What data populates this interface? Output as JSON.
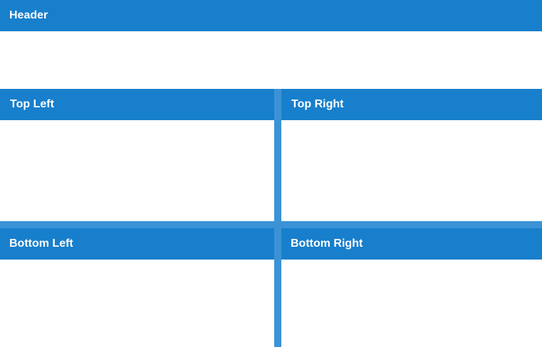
{
  "header": {
    "title": "Header"
  },
  "panes": {
    "top_left": {
      "title": "Top Left"
    },
    "top_right": {
      "title": "Top Right"
    },
    "bottom_left": {
      "title": "Bottom Left"
    },
    "bottom_right": {
      "title": "Bottom Right"
    }
  },
  "colors": {
    "header_bg": "#187fcc",
    "splitter": "#3b93d6",
    "header_text": "#ffffff",
    "body_bg": "#ffffff"
  }
}
